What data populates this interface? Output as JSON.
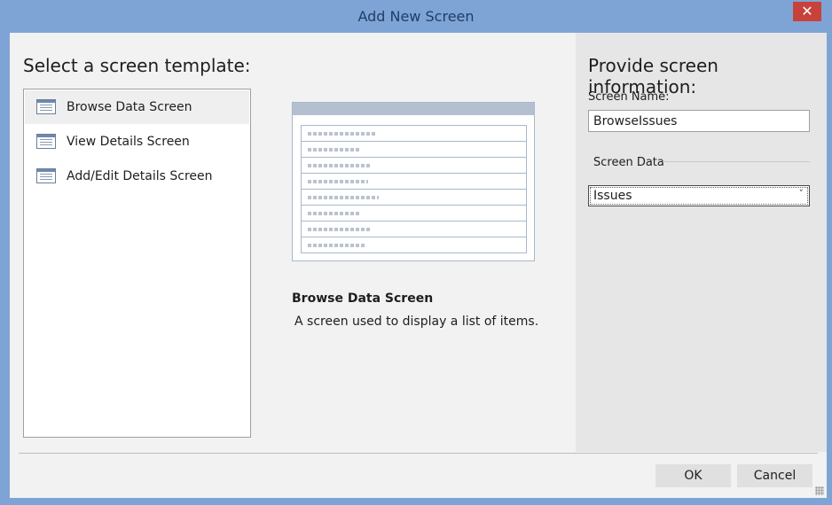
{
  "window": {
    "title": "Add New Screen",
    "close_glyph": "✕",
    "accent_color": "#7ea4d6",
    "close_color": "#c7423a"
  },
  "left": {
    "heading": "Select a screen template:",
    "templates": [
      {
        "label": "Browse Data Screen",
        "icon": "table-list-icon",
        "selected": true
      },
      {
        "label": "View Details Screen",
        "icon": "details-form-icon",
        "selected": false
      },
      {
        "label": "Add/Edit Details Screen",
        "icon": "edit-form-icon",
        "selected": false
      }
    ]
  },
  "preview": {
    "title": "Browse Data Screen",
    "description": "A screen used to display a list of items."
  },
  "right": {
    "heading": "Provide screen information:",
    "screen_name_label": "Screen Name:",
    "screen_name_value": "BrowseIssues",
    "screen_data_label": "Screen Data",
    "screen_data_value": "Issues",
    "dropdown_glyph": "˅"
  },
  "buttons": {
    "ok": "OK",
    "cancel": "Cancel"
  }
}
